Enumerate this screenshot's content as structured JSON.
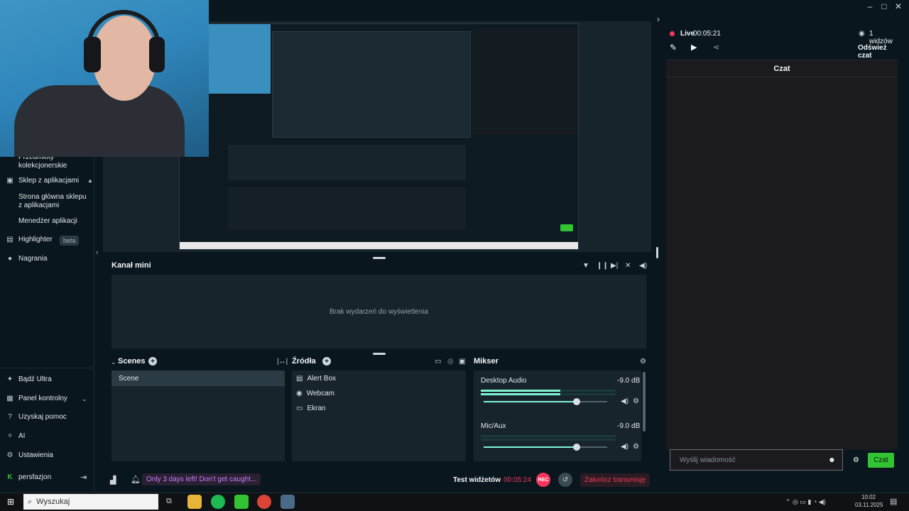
{
  "sidebar": {
    "items": [
      {
        "label": "Przedmioty kolekcjonerskie",
        "icon": "collectibles-icon"
      },
      {
        "label": "Sklep z aplikacjami",
        "icon": "store-icon"
      },
      {
        "label": "Strona główna sklepu z aplikacjami",
        "icon": ""
      },
      {
        "label": "Menedżer aplikacji",
        "icon": ""
      },
      {
        "label": "Highlighter",
        "icon": "highlighter-icon",
        "badge": "beta"
      },
      {
        "label": "Nagrania",
        "icon": "recordings-icon"
      }
    ],
    "bottom": [
      {
        "label": "Bądź Ultra",
        "icon": "ultra-icon"
      },
      {
        "label": "Panel kontrolny",
        "icon": "dashboard-icon"
      },
      {
        "label": "Uzyskaj pomoc",
        "icon": "help-icon"
      },
      {
        "label": "AI",
        "icon": "ai-icon"
      },
      {
        "label": "Ustawienia",
        "icon": "settings-icon"
      }
    ],
    "user": "persfazjon"
  },
  "live": {
    "status": "Live",
    "time": "00:05:21",
    "viewers": "1 widzów",
    "refresh": "Odśwież czat",
    "chat_title": "Czat",
    "input_placeholder": "Wyślij wiadomość",
    "send": "Czat"
  },
  "minifeed": {
    "title": "Kanał mini",
    "empty": "Brak wydarzeń do wyświetlenia"
  },
  "scenes": {
    "title": "Scenes",
    "items": [
      "Scene"
    ]
  },
  "sources": {
    "title": "Źródła",
    "items": [
      "Alert Box",
      "Webcam",
      "Ekran"
    ]
  },
  "mixer": {
    "title": "Mikser",
    "channels": [
      {
        "name": "Desktop Audio",
        "db": "-9.0 dB",
        "volume": 0.75
      },
      {
        "name": "Mic/Aux",
        "db": "-9.0 dB",
        "volume": 0.75
      }
    ]
  },
  "footer": {
    "promo": "Only 3 days left! Don't get caught...",
    "test": "Test widżetów",
    "time": "00:05:24",
    "rec": "REC",
    "end": "Zakończ transmisję"
  },
  "taskbar": {
    "search": "Wyszukaj",
    "time": "10:02",
    "date": "03.11.2025"
  },
  "colors": {
    "accent": "#80f5d2",
    "live": "#f5365c",
    "send": "#31c331",
    "promo": "#c87dff"
  }
}
